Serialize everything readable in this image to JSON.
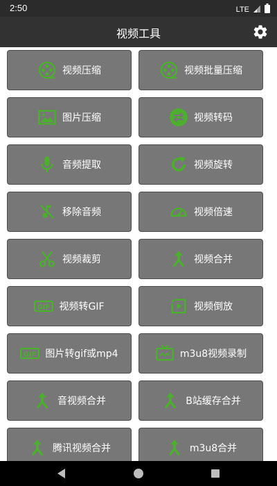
{
  "status_bar": {
    "time": "2:50",
    "network": "LTE"
  },
  "app_bar": {
    "title": "视频工具"
  },
  "colors": {
    "accent": "#4caf2e",
    "tile": "#777777",
    "app_bar": "#323232",
    "status_bar": "#2b2b2b"
  },
  "tools": [
    {
      "label": "视频压缩",
      "icon": "film-reel-icon"
    },
    {
      "label": "视频批量压缩",
      "icon": "film-reel-icon"
    },
    {
      "label": "图片压缩",
      "icon": "image-icon"
    },
    {
      "label": "视频转码",
      "icon": "swap-icon"
    },
    {
      "label": "音频提取",
      "icon": "microphone-icon"
    },
    {
      "label": "视频旋转",
      "icon": "rotate-icon"
    },
    {
      "label": "移除音频",
      "icon": "music-off-icon"
    },
    {
      "label": "视频倍速",
      "icon": "speedometer-icon"
    },
    {
      "label": "视频裁剪",
      "icon": "scissors-icon"
    },
    {
      "label": "视频合并",
      "icon": "merge-icon"
    },
    {
      "label": "视频转GIF",
      "icon": "gif-icon"
    },
    {
      "label": "视频倒放",
      "icon": "reverse-play-icon"
    },
    {
      "label": "图片转gif或mp4",
      "icon": "gif-icon"
    },
    {
      "label": "m3u8视频录制",
      "icon": "tv-icon"
    },
    {
      "label": "音视频合并",
      "icon": "merge-icon"
    },
    {
      "label": "B站缓存合并",
      "icon": "merge-icon"
    },
    {
      "label": "腾讯视频合并",
      "icon": "merge-icon"
    },
    {
      "label": "m3u8合并",
      "icon": "merge-icon"
    }
  ]
}
